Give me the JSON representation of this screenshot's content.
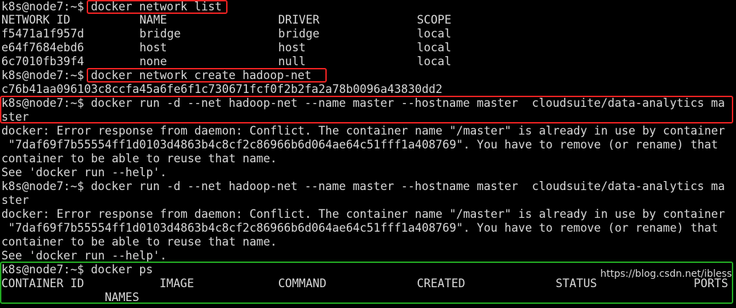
{
  "terminal": {
    "prompt": "k8s@node7:~$",
    "cmd_network_list": "docker network list",
    "network_table": {
      "headers": [
        "NETWORK ID",
        "NAME",
        "DRIVER",
        "SCOPE"
      ],
      "rows": [
        [
          "f5471a1f957d",
          "bridge",
          "bridge",
          "local"
        ],
        [
          "e64f7684ebd6",
          "host",
          "host",
          "local"
        ],
        [
          "6c7010fb39f4",
          "none",
          "null",
          "local"
        ]
      ]
    },
    "cmd_network_create": "docker network create hadoop-net",
    "network_create_output": "c76b41aa096103c8ccfa45a6fe6f1c730671fcf0f2b2fa2a78b0096a43830dd2",
    "cmd_run_line1": "docker run -d --net hadoop-net --name master --hostname master  cloudsuite/data-analytics ma",
    "cmd_run_line2": "ster",
    "error_line1": "docker: Error response from daemon: Conflict. The container name \"/master\" is already in use by container",
    "error_line2": " \"7daf69f7b55554ff1d0103d4863b4c8cf2c86966b6d064ae64c51fff1a408769\". You have to remove (or rename) that",
    "error_line3": "container to be able to reuse that name.",
    "error_line4": "See 'docker run --help'.",
    "cmd_ps": "docker ps",
    "ps_headers": [
      "CONTAINER ID",
      "IMAGE",
      "COMMAND",
      "CREATED",
      "STATUS",
      "PORTS"
    ],
    "ps_headers_wrap": "NAMES",
    "watermark": "https://blog.csdn.net/ibless"
  },
  "colors": {
    "background": "#000000",
    "text": "#d8d8d8",
    "highlight_red": "#ee2222",
    "highlight_green": "#22aa22"
  }
}
